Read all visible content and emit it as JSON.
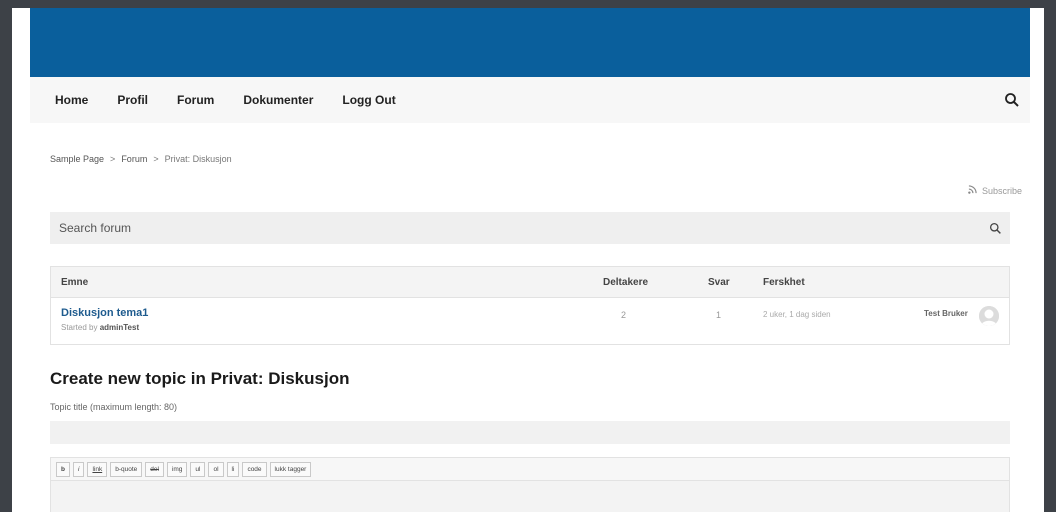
{
  "nav": {
    "items": [
      {
        "label": "Home"
      },
      {
        "label": "Profil"
      },
      {
        "label": "Forum"
      },
      {
        "label": "Dokumenter"
      },
      {
        "label": "Logg Out"
      }
    ]
  },
  "breadcrumb": {
    "items": [
      "Sample Page",
      "Forum"
    ],
    "separator": ">",
    "current": "Privat: Diskusjon"
  },
  "subscribe": {
    "label": "Subscribe"
  },
  "search": {
    "placeholder": "Search forum"
  },
  "table": {
    "headers": {
      "topic": "Emne",
      "participants": "Deltakere",
      "replies": "Svar",
      "freshness": "Ferskhet"
    },
    "rows": [
      {
        "title": "Diskusjon tema1",
        "started_prefix": "Started by",
        "started_by": "adminTest",
        "participants": "2",
        "replies": "1",
        "freshness": "2 uker, 1 dag siden",
        "last_author": "Test Bruker"
      }
    ]
  },
  "create": {
    "heading": "Create new topic in Privat: Diskusjon",
    "title_label": "Topic title (maximum length: 80)",
    "title_value": ""
  },
  "editor": {
    "buttons": [
      "b",
      "i",
      "link",
      "b-quote",
      "del",
      "img",
      "ul",
      "ol",
      "li",
      "code",
      "lukk tagger"
    ]
  },
  "colors": {
    "header_blue": "#0a5f9c",
    "link_blue": "#1e5b8e",
    "outer_background": "#3d4147"
  }
}
